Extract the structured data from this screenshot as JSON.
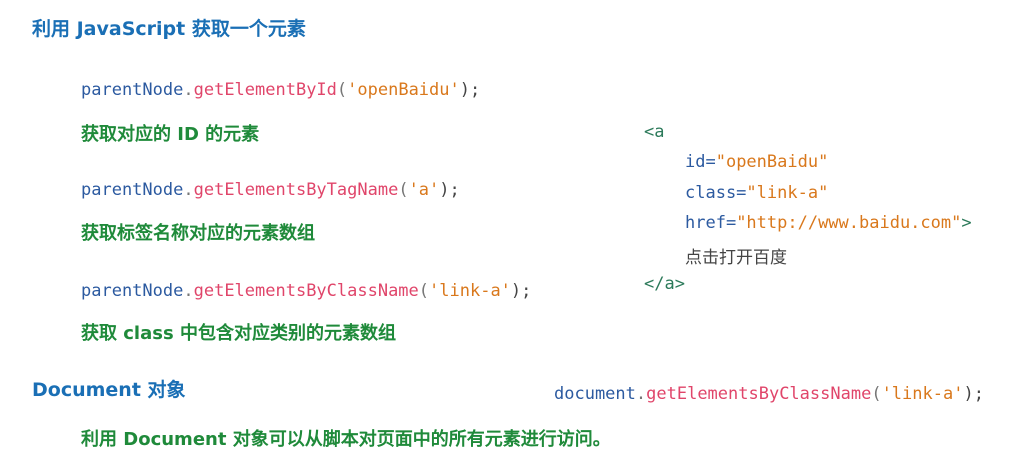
{
  "title": "利用 JavaScript 获取一个元素",
  "methods": [
    {
      "object": "parentNode",
      "dot": ".",
      "method": "getElementById",
      "open_paren": "(",
      "arg": "'openBaidu'",
      "close": ");",
      "description": "获取对应的 ID 的元素"
    },
    {
      "object": "parentNode",
      "dot": ".",
      "method": "getElementsByTagName",
      "open_paren": "(",
      "arg": "'a'",
      "close": ");",
      "description": "获取标签名称对应的元素数组"
    },
    {
      "object": "parentNode",
      "dot": ".",
      "method": "getElementsByClassName",
      "open_paren": "(",
      "arg": "'link-a'",
      "close": ");",
      "description": "获取 class 中包含对应类别的元素数组"
    }
  ],
  "html_example": {
    "open_tag": "<a",
    "id_attr": "id=",
    "id_val": "\"openBaidu\"",
    "class_attr": "class=",
    "class_val": "\"link-a\"",
    "href_attr": "href=",
    "href_val": "\"http://www.baidu.com\"",
    "tag_end": ">",
    "text": "点击打开百度",
    "close_tag": "</a>"
  },
  "document_section": {
    "heading": "Document 对象",
    "code_object": "document",
    "code_dot": ".",
    "code_method": "getElementsByClassName",
    "code_open": "(",
    "code_arg": "'link-a'",
    "code_close": ");",
    "description": "利用 Document 对象可以从脚本对页面中的所有元素进行访问。"
  },
  "colors": {
    "heading": "#1a6fb5",
    "description": "#1f8a3a",
    "method": "#e0456a",
    "string": "#d9781c",
    "object": "#2c5aa0"
  }
}
